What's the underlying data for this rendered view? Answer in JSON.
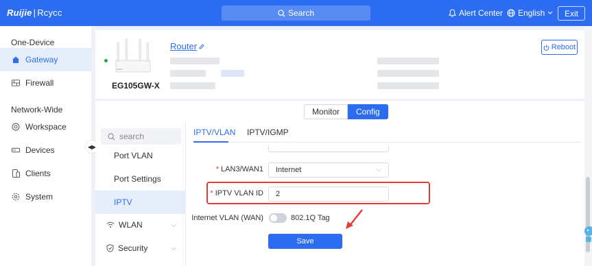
{
  "topbar": {
    "brand": "Ruijie",
    "brand_sub": "Rcycc",
    "search_label": "Search",
    "alert_label": "Alert Center",
    "language": "English",
    "exit_label": "Exit"
  },
  "leftnav": {
    "section_one_device": "One-Device",
    "section_network_wide": "Network-Wide",
    "items": {
      "gateway": "Gateway",
      "firewall": "Firewall",
      "workspace": "Workspace",
      "devices": "Devices",
      "clients": "Clients",
      "system": "System"
    }
  },
  "device": {
    "name": "Router",
    "model": "EG105GW-X",
    "reboot_label": "Reboot",
    "status_color": "#1aa84b"
  },
  "mode_switch": {
    "monitor": "Monitor",
    "config": "Config",
    "selected": "Config"
  },
  "subnav": {
    "search_placeholder": "search",
    "items": {
      "port_vlan": "Port VLAN",
      "port_settings": "Port Settings",
      "iptv": "IPTV",
      "wlan": "WLAN",
      "security": "Security"
    }
  },
  "tabs": {
    "iptv_vlan": "IPTV/VLAN",
    "iptv_igmp": "IPTV/IGMP",
    "active": "IPTV/VLAN"
  },
  "form": {
    "lan3_label": "LAN3/WAN1",
    "lan3_value": "Internet",
    "iptv_vlan_id_label": "IPTV VLAN ID",
    "iptv_vlan_id_value": "2",
    "internet_vlan_label": "Internet VLAN (WAN)",
    "tag_label": "802.1Q Tag",
    "tag_enabled": false,
    "save_label": "Save"
  },
  "colors": {
    "accent": "#2b6cf0",
    "highlight": "#e53935"
  }
}
